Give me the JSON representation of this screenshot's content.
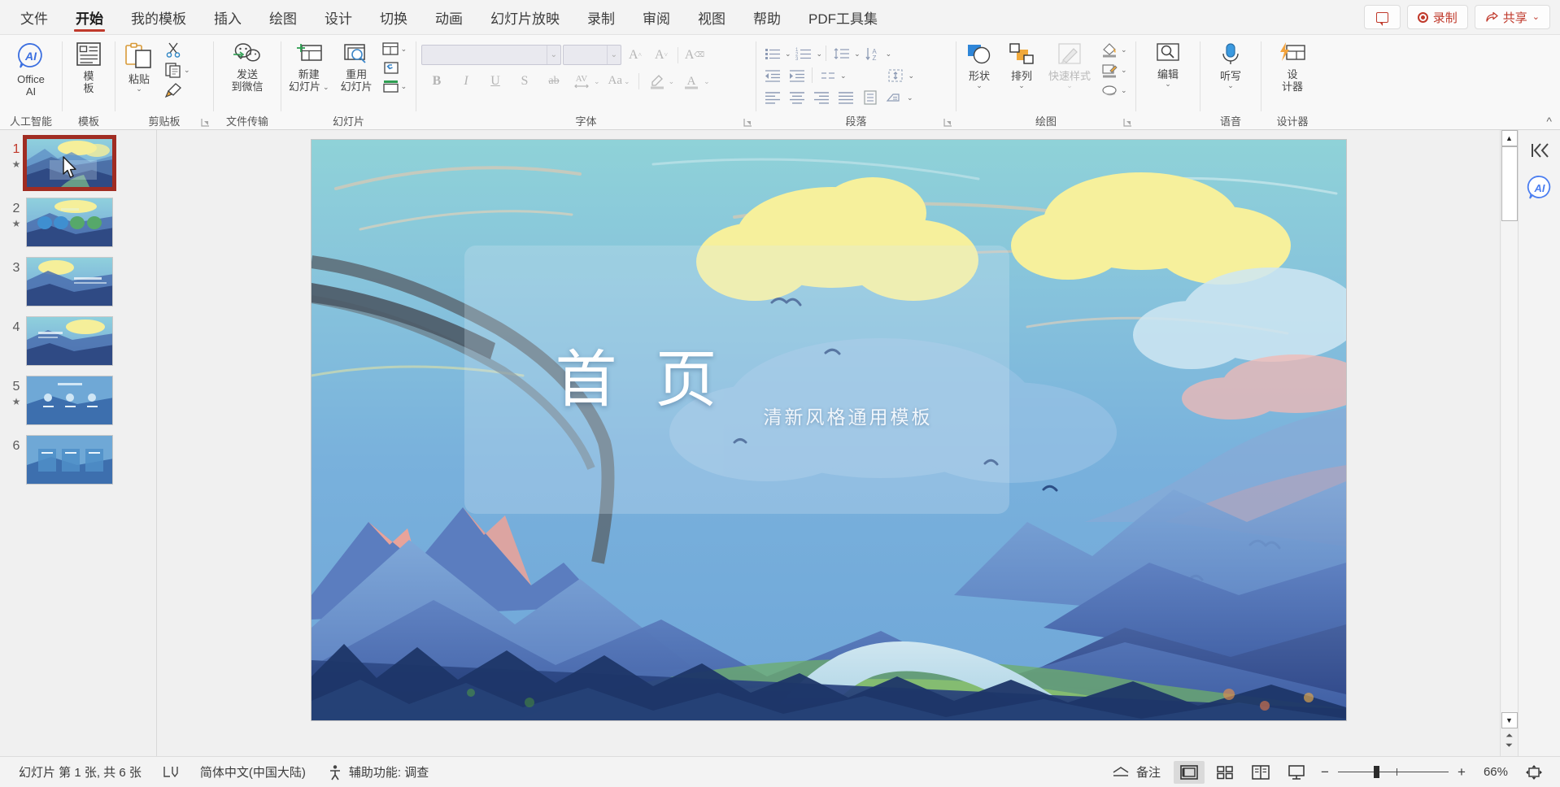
{
  "menubar": {
    "tabs": [
      {
        "label": "文件",
        "active": false
      },
      {
        "label": "开始",
        "active": true
      },
      {
        "label": "我的模板",
        "active": false
      },
      {
        "label": "插入",
        "active": false
      },
      {
        "label": "绘图",
        "active": false
      },
      {
        "label": "设计",
        "active": false
      },
      {
        "label": "切换",
        "active": false
      },
      {
        "label": "动画",
        "active": false
      },
      {
        "label": "幻灯片放映",
        "active": false
      },
      {
        "label": "录制",
        "active": false
      },
      {
        "label": "审阅",
        "active": false
      },
      {
        "label": "视图",
        "active": false
      },
      {
        "label": "帮助",
        "active": false
      },
      {
        "label": "PDF工具集",
        "active": false
      }
    ],
    "comment_button": "",
    "record_button": "录制",
    "share_button": "共享",
    "accent_color": "#c0392b"
  },
  "ribbon": {
    "groups": [
      {
        "name": "人工智能",
        "label": "人工智能",
        "buttons": [
          {
            "label": "Office",
            "label2": "AI",
            "icon": "office-ai-icon"
          }
        ]
      },
      {
        "name": "模板",
        "label": "模板",
        "buttons": [
          {
            "label": "模",
            "label2": "板",
            "icon": "template-icon"
          }
        ]
      },
      {
        "name": "剪贴板",
        "label": "剪贴板",
        "buttons": [
          {
            "label": "粘贴",
            "icon": "paste-icon"
          },
          {
            "label": "",
            "icon": "cut-icon"
          },
          {
            "label": "",
            "icon": "copy-icon"
          },
          {
            "label": "",
            "icon": "format-painter-icon"
          }
        ]
      },
      {
        "name": "文件传输",
        "label": "文件传输",
        "buttons": [
          {
            "label": "发送",
            "label2": "到微信",
            "icon": "wechat-send-icon"
          }
        ]
      },
      {
        "name": "幻灯片",
        "label": "幻灯片",
        "buttons": [
          {
            "label": "新建",
            "label2": "幻灯片",
            "icon": "new-slide-icon"
          },
          {
            "label": "重用",
            "label2": "幻灯片",
            "icon": "reuse-slide-icon"
          },
          {
            "label": "",
            "icon": "layout-icon"
          },
          {
            "label": "",
            "icon": "reset-icon"
          },
          {
            "label": "",
            "icon": "section-icon"
          }
        ]
      },
      {
        "name": "字体",
        "label": "字体",
        "font_name_value": "",
        "font_size_value": "",
        "buttons": [
          {
            "label": "A",
            "icon": "grow-font-icon"
          },
          {
            "label": "A",
            "icon": "shrink-font-icon"
          },
          {
            "label": "A",
            "icon": "clear-format-icon"
          },
          {
            "label": "B",
            "icon": "bold-icon"
          },
          {
            "label": "I",
            "icon": "italic-icon"
          },
          {
            "label": "U",
            "icon": "underline-icon"
          },
          {
            "label": "S",
            "icon": "shadow-icon"
          },
          {
            "label": "ab",
            "icon": "strikethrough-icon"
          },
          {
            "label": "AV",
            "icon": "character-spacing-icon"
          },
          {
            "label": "Aa",
            "icon": "change-case-icon"
          },
          {
            "label": "",
            "icon": "text-highlight-icon"
          },
          {
            "label": "A",
            "icon": "font-color-icon"
          }
        ]
      },
      {
        "name": "段落",
        "label": "段落",
        "buttons": [
          {
            "icon": "bullets-icon"
          },
          {
            "icon": "numbering-icon"
          },
          {
            "icon": "line-spacing-icon"
          },
          {
            "icon": "text-direction-sort-icon"
          },
          {
            "icon": "decrease-indent-icon"
          },
          {
            "icon": "increase-indent-icon"
          },
          {
            "icon": "text-direction-icon"
          },
          {
            "icon": "align-text-icon"
          },
          {
            "icon": "align-left-icon"
          },
          {
            "icon": "align-center-icon"
          },
          {
            "icon": "align-right-icon"
          },
          {
            "icon": "justify-icon"
          },
          {
            "icon": "columns-icon"
          },
          {
            "icon": "convert-smartart-icon"
          }
        ]
      },
      {
        "name": "绘图",
        "label": "绘图",
        "buttons": [
          {
            "label": "形状",
            "icon": "shapes-icon"
          },
          {
            "label": "排列",
            "icon": "arrange-icon"
          },
          {
            "label": "快速样式",
            "icon": "quick-styles-icon",
            "disabled": true
          },
          {
            "icon": "shape-fill-icon"
          },
          {
            "icon": "shape-outline-icon"
          },
          {
            "icon": "shape-effects-icon"
          }
        ]
      },
      {
        "name": "编辑",
        "label": "",
        "buttons": [
          {
            "label": "编辑",
            "icon": "find-icon"
          }
        ]
      },
      {
        "name": "语音",
        "label": "语音",
        "buttons": [
          {
            "label": "听写",
            "icon": "microphone-icon"
          }
        ]
      },
      {
        "name": "设计器",
        "label": "设计器",
        "buttons": [
          {
            "label": "设",
            "label2": "计器",
            "icon": "designer-icon"
          }
        ]
      }
    ],
    "collapse_label": "^"
  },
  "thumbnails": {
    "slides": [
      {
        "number": "1",
        "starred": true,
        "selected": true
      },
      {
        "number": "2",
        "starred": true,
        "selected": false
      },
      {
        "number": "3",
        "starred": false,
        "selected": false
      },
      {
        "number": "4",
        "starred": false,
        "selected": false
      },
      {
        "number": "5",
        "starred": true,
        "selected": false
      },
      {
        "number": "6",
        "starred": false,
        "selected": false
      }
    ],
    "star_glyph": "★"
  },
  "slide": {
    "title": "首 页",
    "subtitle": "清新风格通用模板",
    "title_color": "#ffffff",
    "subtitle_color": "#f2f6fb"
  },
  "rightrail": {
    "collapse_icon": "|<<",
    "ai_badge": "AI"
  },
  "statusbar": {
    "slide_count": "幻灯片 第 1 张, 共 6 张",
    "language": "简体中文(中国大陆)",
    "accessibility": "辅助功能: 调查",
    "notes": "备注",
    "views": [
      {
        "name": "normal-view",
        "active": true
      },
      {
        "name": "slide-sorter-view",
        "active": false
      },
      {
        "name": "reading-view",
        "active": false
      },
      {
        "name": "slideshow-view",
        "active": false
      }
    ],
    "zoom_out": "−",
    "zoom_in": "+",
    "zoom_value": "66%",
    "fit_label": "适应窗口"
  }
}
